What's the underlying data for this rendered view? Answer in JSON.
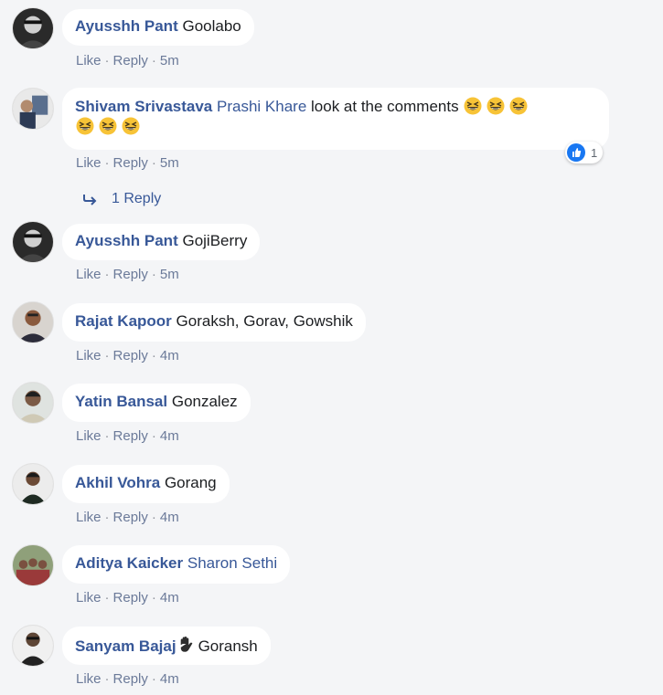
{
  "comments": [
    {
      "author": "Ayusshh Pant",
      "text": "Goolabo",
      "actions": {
        "like": "Like",
        "reply": "Reply",
        "time": "5m"
      }
    },
    {
      "author": "Shivam Srivastava",
      "mention": "Prashi Khare",
      "text": "look at the comments",
      "emojis": [
        "grinning-squinting-face",
        "grinning-squinting-face",
        "grinning-squinting-face",
        "grinning-squinting-face",
        "grinning-squinting-face",
        "grinning-squinting-face"
      ],
      "reaction": {
        "icon": "like-icon",
        "count": "1"
      },
      "actions": {
        "like": "Like",
        "reply": "Reply",
        "time": "5m"
      },
      "replies_link": "1 Reply"
    },
    {
      "author": "Ayusshh Pant",
      "text": "GojiBerry",
      "actions": {
        "like": "Like",
        "reply": "Reply",
        "time": "5m"
      }
    },
    {
      "author": "Rajat Kapoor",
      "text": "Goraksh, Gorav, Gowshik",
      "actions": {
        "like": "Like",
        "reply": "Reply",
        "time": "4m"
      }
    },
    {
      "author": "Yatin Bansal",
      "text": "Gonzalez",
      "actions": {
        "like": "Like",
        "reply": "Reply",
        "time": "4m"
      }
    },
    {
      "author": "Akhil Vohra",
      "text": "Gorang",
      "actions": {
        "like": "Like",
        "reply": "Reply",
        "time": "4m"
      }
    },
    {
      "author": "Aditya Kaicker",
      "text": "Sharon Sethi",
      "actions": {
        "like": "Like",
        "reply": "Reply",
        "time": "4m"
      }
    },
    {
      "author": "Sanyam Bajaj",
      "text": "Goransh",
      "emoji_after_name": "raised-hand-icon",
      "actions": {
        "like": "Like",
        "reply": "Reply",
        "time": "4m"
      }
    }
  ],
  "colors": {
    "background": "#f4f5f7",
    "bubble": "#ffffff",
    "name": "#385898",
    "meta": "#6b7a99",
    "like_blue": "#1877f2"
  }
}
